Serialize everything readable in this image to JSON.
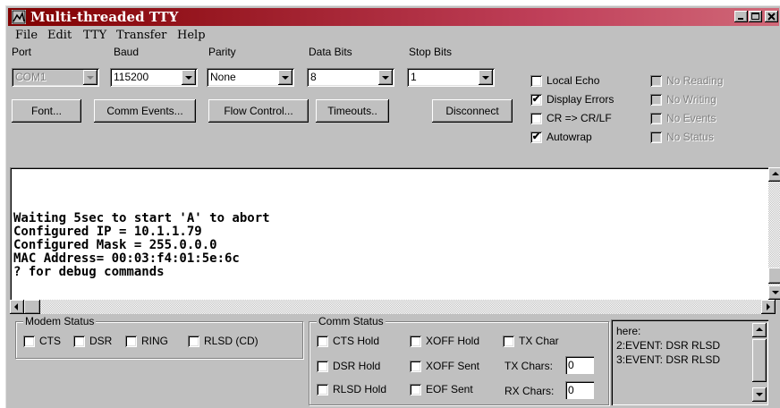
{
  "window": {
    "title": "Multi-threaded TTY"
  },
  "menu": [
    "File",
    "Edit",
    "TTY",
    "Transfer",
    "Help"
  ],
  "settings": {
    "port": {
      "label": "Port",
      "value": "COM1"
    },
    "baud": {
      "label": "Baud",
      "value": "115200"
    },
    "parity": {
      "label": "Parity",
      "value": "None"
    },
    "data_bits": {
      "label": "Data Bits",
      "value": "8"
    },
    "stop_bits": {
      "label": "Stop Bits",
      "value": "1"
    }
  },
  "buttons": {
    "font": "Font...",
    "comm_events": "Comm Events...",
    "flow_control": "Flow Control...",
    "timeouts": "Timeouts..",
    "disconnect": "Disconnect"
  },
  "options": [
    {
      "label": "Local Echo",
      "checked": false
    },
    {
      "label": "Display Errors",
      "checked": true
    },
    {
      "label": "CR => CR/LF",
      "checked": false
    },
    {
      "label": "Autowrap",
      "checked": true
    }
  ],
  "disabled_options": [
    "No Reading",
    "No Writing",
    "No Events",
    "No Status"
  ],
  "terminal": {
    "lines": [
      "Waiting 5sec to start 'A' to abort",
      "Configured IP = 10.1.1.79",
      "Configured Mask = 255.0.0.0",
      "MAC Address= 00:03:f4:01:5e:6c",
      "? for debug commands"
    ]
  },
  "modem_status": {
    "title": "Modem Status",
    "items": [
      "CTS",
      "DSR",
      "RING",
      "RLSD (CD)"
    ]
  },
  "comm_status": {
    "title": "Comm Status",
    "cts_hold": "CTS Hold",
    "xoff_hold": "XOFF Hold",
    "tx_char": "TX Char",
    "dsr_hold": "DSR Hold",
    "xoff_sent": "XOFF Sent",
    "tx_chars_label": "TX Chars:",
    "tx_chars_value": "0",
    "rlsd_hold": "RLSD Hold",
    "eof_sent": "EOF Sent",
    "rx_chars_label": "RX Chars:",
    "rx_chars_value": "0"
  },
  "events": [
    "here:",
    "2:EVENT: DSR RLSD",
    "3:EVENT: DSR RLSD"
  ],
  "check_mark": "✔"
}
